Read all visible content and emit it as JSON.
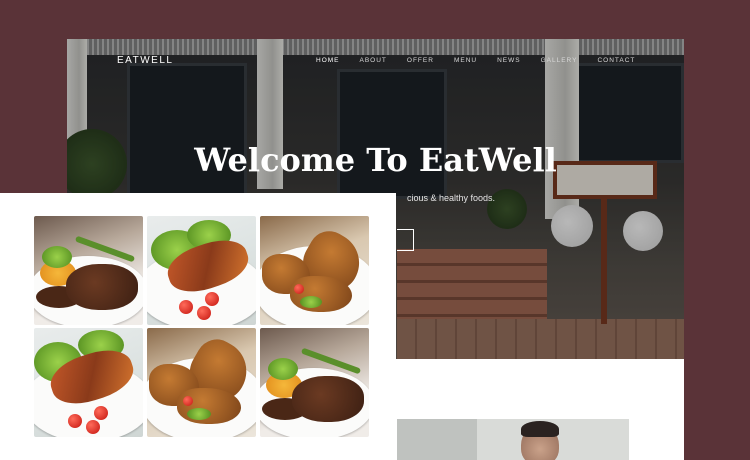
{
  "site": {
    "brand": "EATWELL",
    "nav": [
      {
        "label": "HOME",
        "active": true
      },
      {
        "label": "ABOUT",
        "active": false
      },
      {
        "label": "OFFER",
        "active": false
      },
      {
        "label": "MENU",
        "active": false
      },
      {
        "label": "NEWS",
        "active": false
      },
      {
        "label": "GALLERY",
        "active": false
      },
      {
        "label": "CONTACT",
        "active": false
      }
    ],
    "hero": {
      "headline": "Welcome To EatWell",
      "tagline": "cious & healthy foods."
    }
  },
  "gallery": {
    "tiles": [
      {
        "dish": "steak"
      },
      {
        "dish": "fish"
      },
      {
        "dish": "chicken"
      },
      {
        "dish": "fish"
      },
      {
        "dish": "chicken"
      },
      {
        "dish": "steak"
      }
    ]
  },
  "colors": {
    "background": "#5a3338",
    "text_light": "#ffffff"
  }
}
